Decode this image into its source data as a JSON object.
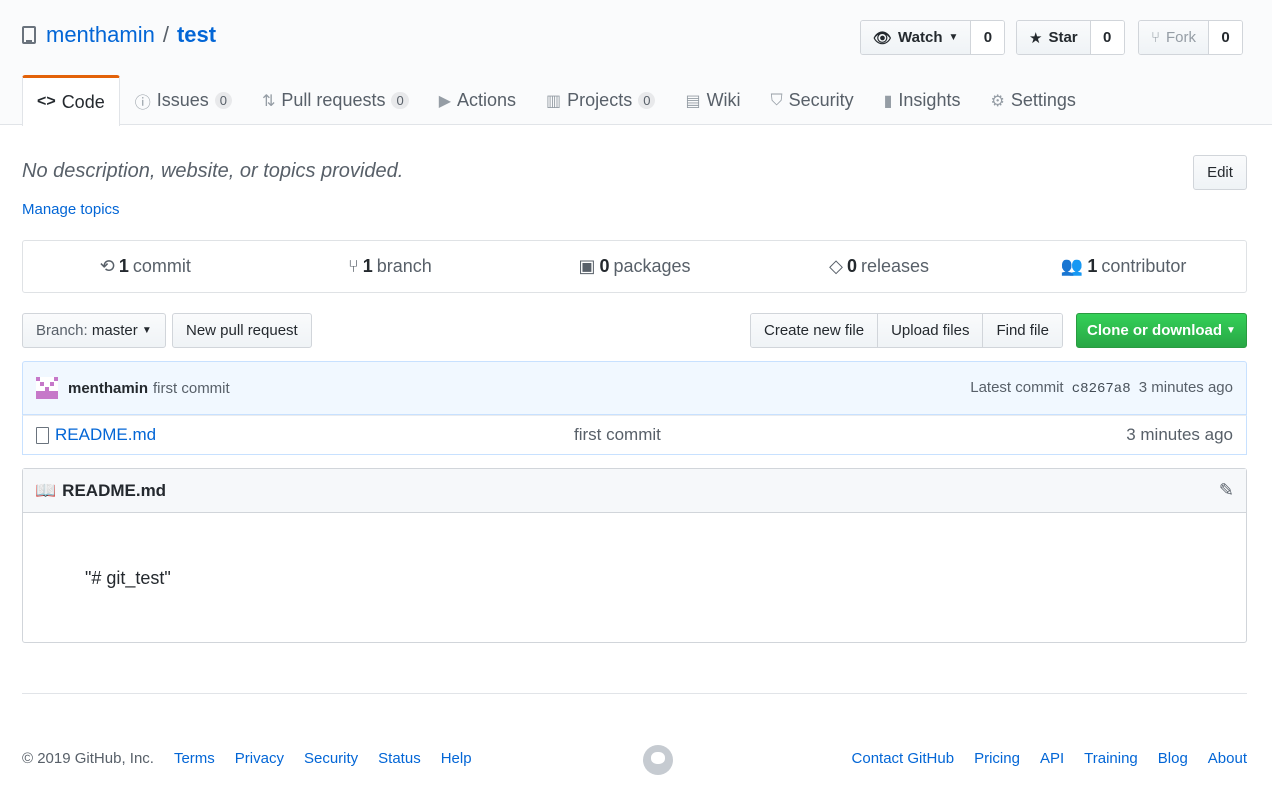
{
  "repo": {
    "owner": "menthamin",
    "separator": "/",
    "name": "test"
  },
  "actions": {
    "watch": {
      "label": "Watch",
      "count": "0"
    },
    "star": {
      "label": "Star",
      "count": "0"
    },
    "fork": {
      "label": "Fork",
      "count": "0"
    }
  },
  "tabs": [
    {
      "label": "Code",
      "icon": "code-icon"
    },
    {
      "label": "Issues",
      "count": "0",
      "icon": "issue-icon"
    },
    {
      "label": "Pull requests",
      "count": "0",
      "icon": "pull-request-icon"
    },
    {
      "label": "Actions",
      "icon": "play-icon"
    },
    {
      "label": "Projects",
      "count": "0",
      "icon": "project-icon"
    },
    {
      "label": "Wiki",
      "icon": "book-icon"
    },
    {
      "label": "Security",
      "icon": "shield-icon"
    },
    {
      "label": "Insights",
      "icon": "graph-icon"
    },
    {
      "label": "Settings",
      "icon": "gear-icon"
    }
  ],
  "description": "No description, website, or topics provided.",
  "manage_topics": "Manage topics",
  "edit_label": "Edit",
  "summary": {
    "commits": {
      "num": "1",
      "label": "commit"
    },
    "branches": {
      "num": "1",
      "label": "branch"
    },
    "packages": {
      "num": "0",
      "label": "packages"
    },
    "releases": {
      "num": "0",
      "label": "releases"
    },
    "contributors": {
      "num": "1",
      "label": "contributor"
    }
  },
  "toolbar": {
    "branch_prefix": "Branch:",
    "branch_name": "master",
    "new_pr": "New pull request",
    "create_file": "Create new file",
    "upload_files": "Upload files",
    "find_file": "Find file",
    "clone": "Clone or download"
  },
  "latest_commit": {
    "author": "menthamin",
    "message": "first commit",
    "prefix": "Latest commit",
    "sha": "c8267a8",
    "age": "3 minutes ago"
  },
  "files": [
    {
      "name": "README.md",
      "message": "first commit",
      "age": "3 minutes ago"
    }
  ],
  "readme": {
    "title": "README.md",
    "content": "\"# git_test\""
  },
  "footer": {
    "copyright": "© 2019 GitHub, Inc.",
    "left_links": [
      "Terms",
      "Privacy",
      "Security",
      "Status",
      "Help"
    ],
    "right_links": [
      "Contact GitHub",
      "Pricing",
      "API",
      "Training",
      "Blog",
      "About"
    ]
  },
  "colors": {
    "accent": "#0366d6",
    "clone_green": "#28a745",
    "tab_orange": "#e36209"
  }
}
